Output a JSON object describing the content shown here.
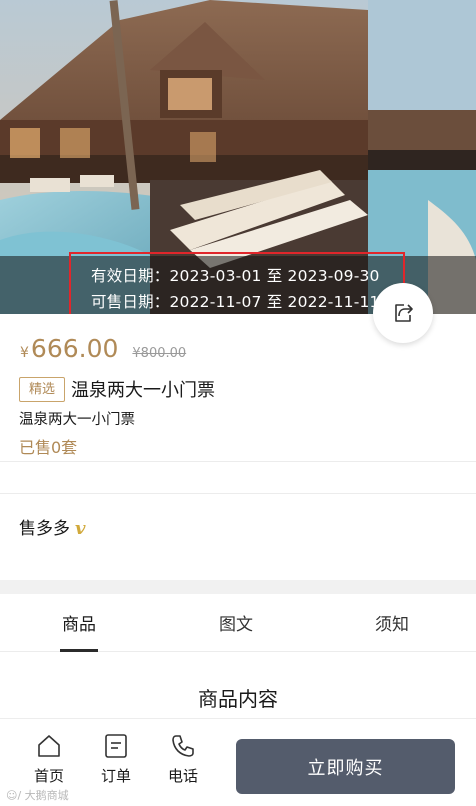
{
  "hero": {
    "valid_date_text": "有效日期：2023-03-01 至 2023-09-30",
    "sale_date_text": "可售日期：2022-11-07 至 2022-11-11",
    "image_subject": "resort pool villa photo"
  },
  "product": {
    "currency": "¥",
    "price": "666.00",
    "original_price": "¥800.00",
    "tag": "精选",
    "title": "温泉两大一小门票",
    "subtitle": "温泉两大一小门票",
    "sold": "已售0套"
  },
  "shop": {
    "name": "售多多",
    "badge": "v"
  },
  "tabs": [
    {
      "label": "商品"
    },
    {
      "label": "图文"
    },
    {
      "label": "须知"
    }
  ],
  "content": {
    "title": "商品内容"
  },
  "bottom_nav": {
    "items": [
      {
        "label": "首页",
        "icon": "home-icon"
      },
      {
        "label": "订单",
        "icon": "order-icon"
      },
      {
        "label": "电话",
        "icon": "phone-icon"
      }
    ],
    "buy_label": "立即购买"
  },
  "watermark": "☺/ 大鹅商城",
  "colors": {
    "accent_gold": "#b08a57",
    "buy_button": "#545c6c",
    "highlight_red": "#e0262b"
  }
}
